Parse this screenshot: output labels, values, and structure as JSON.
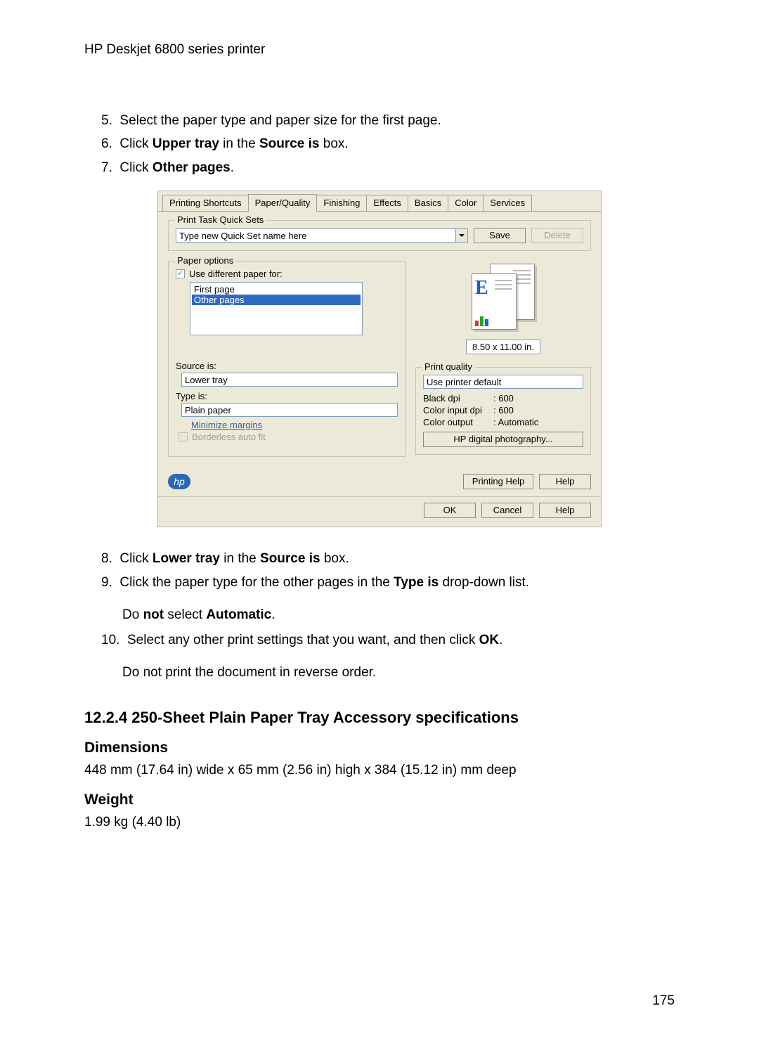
{
  "doc_header": "HP Deskjet 6800 series printer",
  "steps_top": [
    {
      "n": "5.",
      "parts": [
        "Select the paper type and paper size for the first page."
      ]
    },
    {
      "n": "6.",
      "parts": [
        "Click ",
        "Upper tray",
        " in the ",
        "Source is",
        " box."
      ]
    },
    {
      "n": "7.",
      "parts": [
        "Click ",
        "Other pages",
        "."
      ]
    }
  ],
  "dialog": {
    "tabs": [
      "Printing Shortcuts",
      "Paper/Quality",
      "Finishing",
      "Effects",
      "Basics",
      "Color",
      "Services"
    ],
    "active_tab": 1,
    "quicksets": {
      "legend": "Print Task Quick Sets",
      "name_value": "Type new Quick Set name here",
      "save": "Save",
      "delete": "Delete"
    },
    "paper_options": {
      "legend": "Paper options",
      "use_diff_label": "Use different paper for:",
      "list": [
        "First page",
        "Other pages"
      ],
      "source_label": "Source is:",
      "source_value": "Lower tray",
      "type_label": "Type is:",
      "type_value": "Plain paper",
      "minimize": "Minimize margins",
      "borderless": "Borderless auto fit"
    },
    "preview": {
      "size": "8.50 x 11.00 in."
    },
    "print_quality": {
      "legend": "Print quality",
      "value": "Use printer default",
      "black_k": "Black dpi",
      "black_v": ": 600",
      "cin_k": "Color input dpi",
      "cin_v": ": 600",
      "cout_k": "Color output",
      "cout_v": ": Automatic",
      "hp_photo": "HP digital photography..."
    },
    "inner_buttons": {
      "printing_help": "Printing Help",
      "help": "Help"
    },
    "footer": {
      "ok": "OK",
      "cancel": "Cancel",
      "help": "Help"
    }
  },
  "steps_bottom": [
    {
      "n": "8.",
      "parts": [
        "Click ",
        "Lower tray",
        " in the ",
        "Source is",
        " box."
      ]
    },
    {
      "n": "9.",
      "parts": [
        "Click the paper type for the other pages in the ",
        "Type is",
        " drop-down list."
      ],
      "note_parts": [
        "Do ",
        "not",
        " select ",
        "Automatic",
        "."
      ]
    },
    {
      "n": "10.",
      "parts": [
        "Select any other print settings that you want, and then click ",
        "OK",
        "."
      ],
      "note_plain": "Do not print the document in reverse order."
    }
  ],
  "section_heading": "12.2.4  250-Sheet Plain Paper Tray Accessory specifications",
  "dimensions_heading": "Dimensions",
  "dimensions_text": "448 mm (17.64 in) wide x 65 mm (2.56 in) high x 384 (15.12 in) mm deep",
  "weight_heading": "Weight",
  "weight_text": "1.99 kg (4.40 lb)",
  "page_number": "175"
}
